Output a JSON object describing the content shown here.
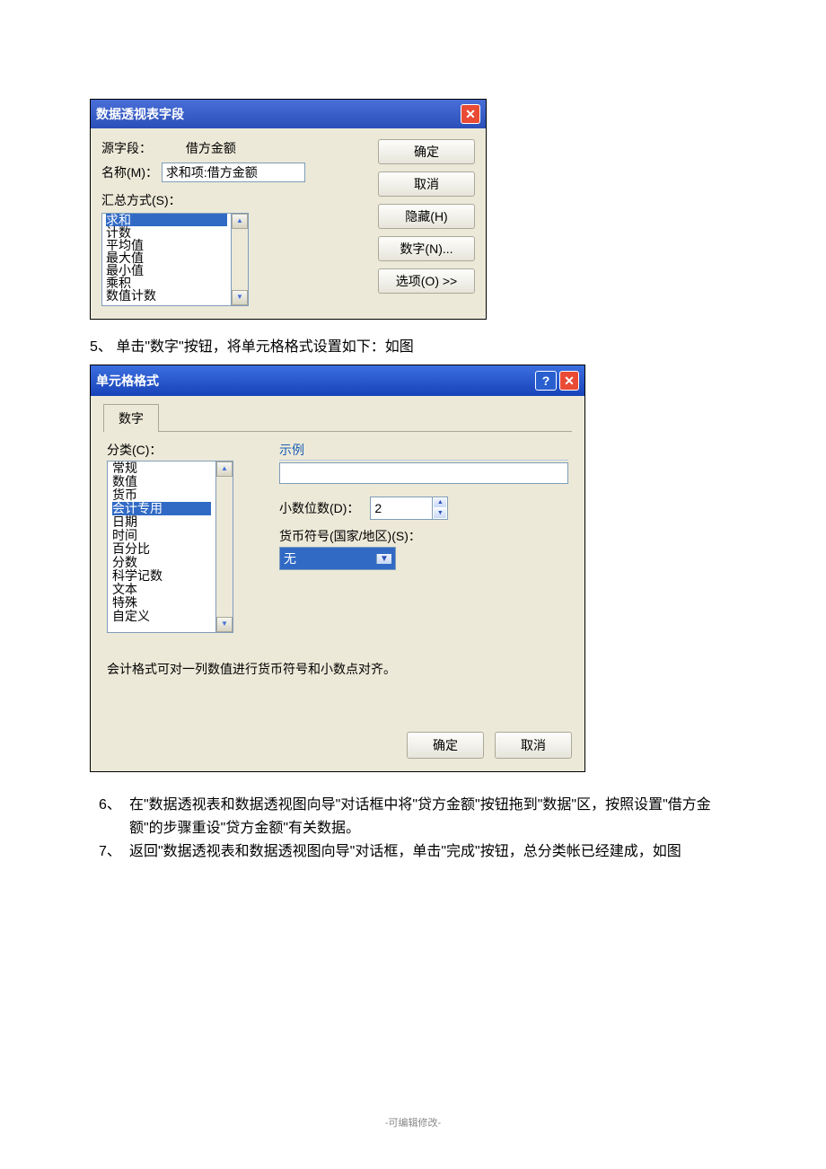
{
  "dlg1": {
    "title": "数据透视表字段",
    "src_label": "源字段：",
    "src_value": "借方金额",
    "name_label": "名称(M)：",
    "name_value": "求和项:借方金额",
    "summary_label": "汇总方式(S)：",
    "items": [
      "求和",
      "计数",
      "平均值",
      "最大值",
      "最小值",
      "乘积",
      "数值计数"
    ],
    "btn_ok": "确定",
    "btn_cancel": "取消",
    "btn_hide": "隐藏(H)",
    "btn_number": "数字(N)...",
    "btn_options": "选项(O) >>"
  },
  "caption5": "5、 单击\"数字\"按钮，将单元格格式设置如下：如图",
  "dlg2": {
    "title": "单元格格式",
    "tab": "数字",
    "cat_label": "分类(C)：",
    "categories": [
      "常规",
      "数值",
      "货币",
      "会计专用",
      "日期",
      "时间",
      "百分比",
      "分数",
      "科学记数",
      "文本",
      "特殊",
      "自定义"
    ],
    "selected_cat_index": 3,
    "sample_label": "示例",
    "dec_label": "小数位数(D)：",
    "dec_value": "2",
    "cur_label": "货币符号(国家/地区)(S)：",
    "cur_value": "无",
    "note": "会计格式可对一列数值进行货币符号和小数点对齐。",
    "btn_ok": "确定",
    "btn_cancel": "取消"
  },
  "para6_n": "6、",
  "para6": "在\"数据透视表和数据透视图向导\"对话框中将\"贷方金额\"按钮拖到\"数据\"区，按照设置\"借方金额\"的步骤重设\"贷方金额\"有关数据。",
  "para7_n": "7、",
  "para7": "返回\"数据透视表和数据透视图向导\"对话框，单击\"完成\"按钮，总分类帐已经建成，如图",
  "footer": "-可编辑修改-"
}
